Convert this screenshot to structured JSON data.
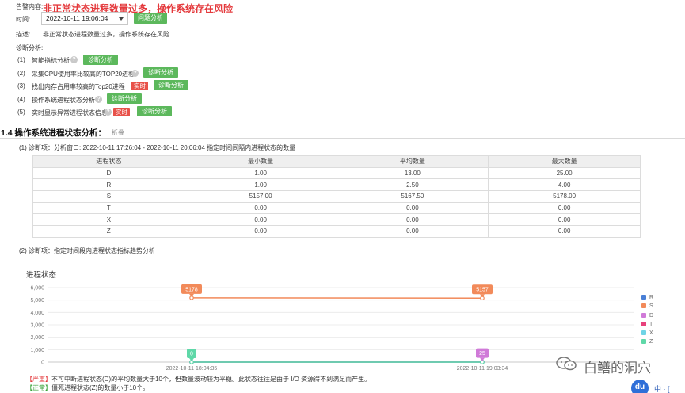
{
  "alert": {
    "label": "告警内容:",
    "title": "非正常状态进程数量过多，操作系统存在风险",
    "time_label": "时间:",
    "time_value": "2022-10-11 19:06:04",
    "problem_button": "问题分析",
    "desc_label": "描述:",
    "desc_value": "非正常状态进程数量过多，操作系统存在风险",
    "diag_label": "诊断分析:"
  },
  "diagnosis_items": [
    {
      "index": "(1)",
      "label": "智能指标分析",
      "button": "诊断分析",
      "realtime": ""
    },
    {
      "index": "(2)",
      "label": "采集CPU使用率比较高的TOP20进程",
      "button": "诊断分析",
      "realtime": ""
    },
    {
      "index": "(3)",
      "label": "找出内存占用率较高的Top20进程",
      "button": "诊断分析",
      "realtime": "实时"
    },
    {
      "index": "(4)",
      "label": "操作系统进程状态分析",
      "button": "诊断分析",
      "realtime": ""
    },
    {
      "index": "(5)",
      "label": "实时显示异常进程状态信息",
      "button": "诊断分析",
      "realtime": "实时"
    }
  ],
  "section": {
    "title": "1.4  操作系统进程状态分析：",
    "fold": "折叠",
    "item1": "(1)  诊断项：分析窗口: 2022-10-11 17:26:04 - 2022-10-11 20:06:04 指定时间间隔内进程状态的数量",
    "item2": "(2)  诊断项：指定时间段内进程状态指标趋势分析"
  },
  "table": {
    "headers": [
      "进程状态",
      "最小数量",
      "平均数量",
      "最大数量"
    ],
    "rows": [
      [
        "D",
        "1.00",
        "13.00",
        "25.00"
      ],
      [
        "R",
        "1.00",
        "2.50",
        "4.00"
      ],
      [
        "S",
        "5157.00",
        "5167.50",
        "5178.00"
      ],
      [
        "T",
        "0.00",
        "0.00",
        "0.00"
      ],
      [
        "X",
        "0.00",
        "0.00",
        "0.00"
      ],
      [
        "Z",
        "0.00",
        "0.00",
        "0.00"
      ]
    ]
  },
  "chart_data": {
    "type": "line",
    "title": "进程状态",
    "xlabel": "",
    "ylabel": "",
    "x": [
      "2022-10-11 18:04:35",
      "2022-10-11 19:03:34"
    ],
    "ylim": [
      0,
      6000
    ],
    "yticks": [
      "0",
      "1,000",
      "2,000",
      "3,000",
      "4,000",
      "5,000",
      "6,000"
    ],
    "grid": true,
    "legend_position": "right",
    "series": [
      {
        "name": "R",
        "color": "#4a7fd6",
        "values": [
          1,
          4
        ]
      },
      {
        "name": "S",
        "color": "#f28a5a",
        "values": [
          5178,
          5157
        ]
      },
      {
        "name": "D",
        "color": "#d07ad8",
        "values": [
          1,
          25
        ]
      },
      {
        "name": "T",
        "color": "#e8417c",
        "values": [
          0,
          0
        ]
      },
      {
        "name": "X",
        "color": "#6fd4e6",
        "values": [
          0,
          0
        ]
      },
      {
        "name": "Z",
        "color": "#5fd8a8",
        "values": [
          0,
          0
        ]
      }
    ],
    "labels": [
      {
        "series": "S",
        "index": 0,
        "text": "5178"
      },
      {
        "series": "S",
        "index": 1,
        "text": "5157"
      },
      {
        "series": "Z",
        "index": 0,
        "text": "0"
      },
      {
        "series": "D",
        "index": 1,
        "text": "25"
      }
    ]
  },
  "notes": [
    {
      "tag": "【严重】",
      "text": "不可中断进程状态(D)的平均数量大于10个，但数量波动较为平稳。此状态往往是由于 I/O 资源得不到满足而产生。"
    },
    {
      "tag": "【正常】",
      "text": "僵死进程状态(Z)的数量小于10个。"
    }
  ],
  "watermark": {
    "text": "白鳝的洞穴",
    "du_text": "du",
    "side_text": "中 · ["
  }
}
